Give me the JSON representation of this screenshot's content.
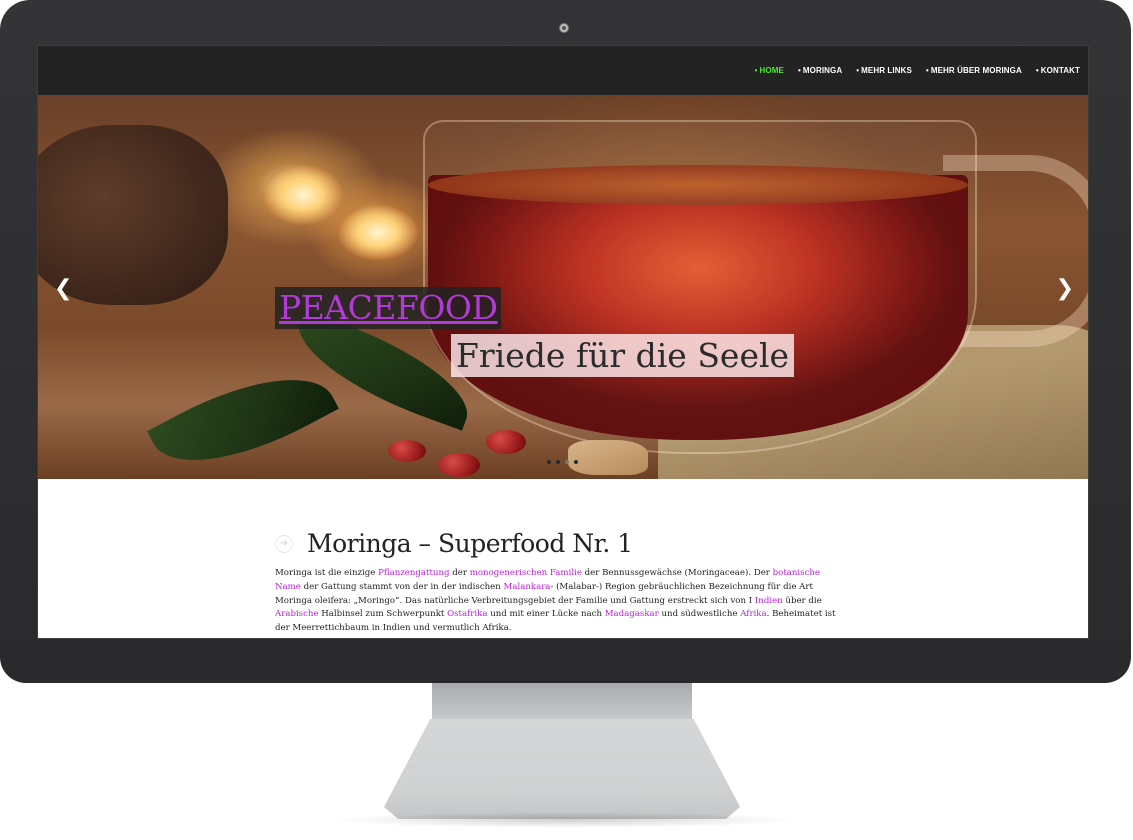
{
  "nav": {
    "items": [
      {
        "label": "HOME",
        "active": true
      },
      {
        "label": "MORINGA",
        "active": false
      },
      {
        "label": "MEHR LINKS",
        "active": false
      },
      {
        "label": "MEHR ÜBER MORINGA",
        "active": false
      },
      {
        "label": "KONTAKT",
        "active": false
      }
    ],
    "bullet": "•"
  },
  "slider": {
    "title": "PEACEFOOD",
    "subtitle": "Friede für die Seele",
    "prev_icon": "chevron-left-icon",
    "next_icon": "chevron-right-icon",
    "slide_count": 4,
    "active_slide": 1
  },
  "article": {
    "heading": "Moringa – Superfood Nr. 1",
    "heading_icon": "arrow-right-circle-icon",
    "p": [
      "Moringa ist die einzige ",
      "Pflanzengattung",
      " der ",
      "monogenerischen Familie",
      " der Bennussgewächse (Moringaceae). Der ",
      "botanische Name",
      " der Gattung stammt von der in der indischen ",
      "Malankara",
      "- (Malabar-) Region gebräuchlichen Bezeichnung für die Art Moringa oleifera: „Moringo“. Das natürliche Verbreitungsgebiet der Familie und Gattung erstreckt sich von I ",
      "Indien",
      " über die ",
      "Arabische",
      " Halbinsel zum Schwerpunkt ",
      "Ostafrika",
      " und mit einer Lücke nach ",
      "Madagaskar",
      " und südwestliche ",
      "Afrika",
      ". Beheimatet ist der Meerrettichbaum in Indien und vermutlich Afrika."
    ]
  },
  "colors": {
    "nav_active": "#54e339",
    "link": "#b721d9",
    "title_color": "#b23ad6"
  }
}
